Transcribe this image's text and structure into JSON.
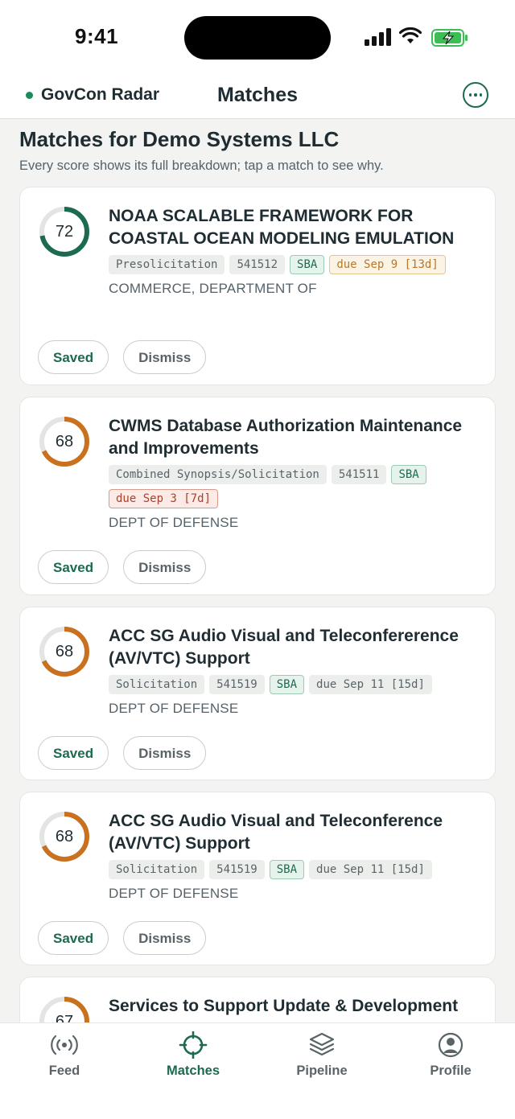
{
  "status": {
    "time": "9:41"
  },
  "header": {
    "brand": "GovCon Radar",
    "title": "Matches"
  },
  "page": {
    "title": "Matches for Demo Systems LLC",
    "subtitle": "Every score shows its full breakdown; tap a match to see why."
  },
  "matches": [
    {
      "score": "72",
      "score_fraction": 0.72,
      "ring_color": "#1c6b4f",
      "title": "NOAA SCALABLE FRAMEWORK FOR COASTAL OCEAN MODELING EMULATION",
      "type": "Presolicitation",
      "naics": "541512",
      "setaside": "SBA",
      "due": "due Sep 9 [13d]",
      "agency": "COMMERCE, DEPARTMENT OF",
      "saved_label": "Saved",
      "dismiss_label": "Dismiss"
    },
    {
      "score": "68",
      "score_fraction": 0.68,
      "ring_color": "#c9711e",
      "title": "CWMS Database Authorization Maintenance and Improvements",
      "type": "Combined Synopsis/Solicitation",
      "naics": "541511",
      "setaside": "SBA",
      "due": "due Sep 3 [7d]",
      "agency": "DEPT OF DEFENSE",
      "saved_label": "Saved",
      "dismiss_label": "Dismiss"
    },
    {
      "score": "68",
      "score_fraction": 0.68,
      "ring_color": "#c9711e",
      "title": "ACC SG Audio Visual and Teleconfererence (AV/VTC) Support",
      "type": "Solicitation",
      "naics": "541519",
      "setaside": "SBA",
      "due": "due Sep 11 [15d]",
      "agency": "DEPT OF DEFENSE",
      "saved_label": "Saved",
      "dismiss_label": "Dismiss"
    },
    {
      "score": "68",
      "score_fraction": 0.68,
      "ring_color": "#c9711e",
      "title": "ACC SG Audio Visual and Teleconference (AV/VTC) Support",
      "type": "Solicitation",
      "naics": "541519",
      "setaside": "SBA",
      "due": "due Sep 11 [15d]",
      "agency": "DEPT OF DEFENSE",
      "saved_label": "Saved",
      "dismiss_label": "Dismiss"
    },
    {
      "score": "67",
      "score_fraction": 0.67,
      "ring_color": "#c9711e",
      "title": "Services to Support Update & Development"
    }
  ],
  "tabs": [
    {
      "label": "Feed",
      "icon": "broadcast-icon"
    },
    {
      "label": "Matches",
      "icon": "crosshair-icon",
      "active": true
    },
    {
      "label": "Pipeline",
      "icon": "layers-icon"
    },
    {
      "label": "Profile",
      "icon": "user-circle-icon"
    }
  ],
  "colors": {
    "accent": "#1c6b4f",
    "warning": "#c9711e",
    "urgent": "#a7432e"
  }
}
